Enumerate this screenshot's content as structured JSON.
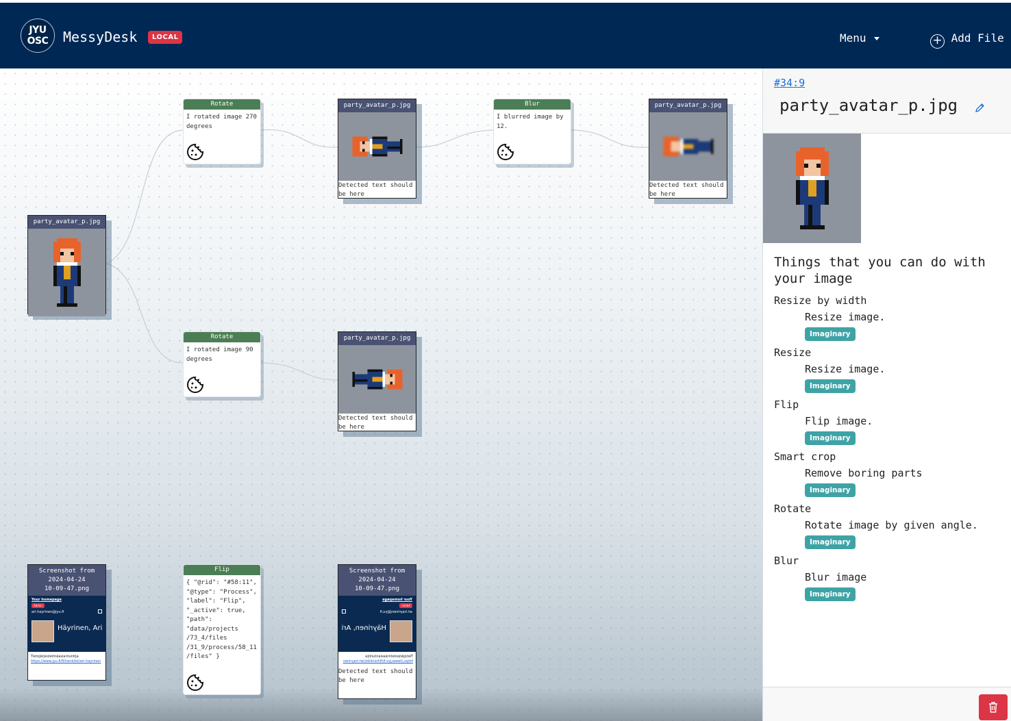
{
  "header": {
    "logo_line1": "JYU",
    "logo_line2": "OSC",
    "app_name": "MessyDesk",
    "env_badge": "LOCAL",
    "menu_label": "Menu",
    "add_file_label": "Add File"
  },
  "canvas": {
    "source_file": {
      "name": "party_avatar_p.jpg"
    },
    "rotate_270": {
      "title": "Rotate",
      "text": "I rotated image 270\ndegrees",
      "icon": "cookie-icon"
    },
    "rotated_270_file": {
      "name": "party_avatar_p.jpg",
      "detected": "Detected text should\nbe here"
    },
    "blur": {
      "title": "Blur",
      "text": "I blurred image by\n12.",
      "icon": "cookie-icon"
    },
    "blurred_file": {
      "name": "party_avatar_p.jpg",
      "detected": "Detected text should\nbe here"
    },
    "rotate_90": {
      "title": "Rotate",
      "text": "I rotated image 90\ndegrees",
      "icon": "cookie-icon"
    },
    "rotated_90_file": {
      "name": "party_avatar_p.jpg",
      "detected": "Detected text should\nbe here"
    },
    "screenshot_file": {
      "name": "Screenshot from\n2024-04-24\n10-09-47.png",
      "homepage": "Your homepage",
      "admin": "Admin",
      "email": "ari.hayrinen@jyu.fi",
      "person": "Häyrinen, Ari",
      "role": "Tietojärjestelmäasiantuntija",
      "link": "https://www.jyu.fi/fi/henkilot/ari-hayrinen"
    },
    "flip": {
      "title": "Flip",
      "text": "{ \"@rid\": \"#58:11\",\n\"@type\": \"Process\",\n\"label\": \"Flip\",\n\"_active\": true,\n\"path\":\n\"data/projects\n/73_4/files\n/31_9/process/58_11\n/files\" }",
      "icon": "cookie-icon"
    },
    "flipped_file": {
      "name": "Screenshot from\n2024-04-24\n10-09-47.png",
      "detected": "Detected text should\nbe here"
    }
  },
  "panel": {
    "record_id": "#34:9",
    "file_name": "party_avatar_p.jpg",
    "heading": "Things that you can do with your image",
    "tools": [
      {
        "name": "Resize by width",
        "description": "Resize image.",
        "badge": "Imaginary"
      },
      {
        "name": "Resize",
        "description": "Resize image.",
        "badge": "Imaginary"
      },
      {
        "name": "Flip",
        "description": "Flip image.",
        "badge": "Imaginary"
      },
      {
        "name": "Smart crop",
        "description": "Remove boring parts",
        "badge": "Imaginary"
      },
      {
        "name": "Rotate",
        "description": "Rotate image by given angle.",
        "badge": "Imaginary"
      },
      {
        "name": "Blur",
        "description": "Blur image",
        "badge": "Imaginary"
      }
    ],
    "delete_icon": "trash-icon"
  },
  "colors": {
    "navbar": "#002855",
    "badge_local": "#dc3545",
    "process_header": "#4c7e56",
    "file_header": "#4a5273",
    "tool_badge": "#3fa3a6",
    "delete_button": "#dc3545"
  }
}
